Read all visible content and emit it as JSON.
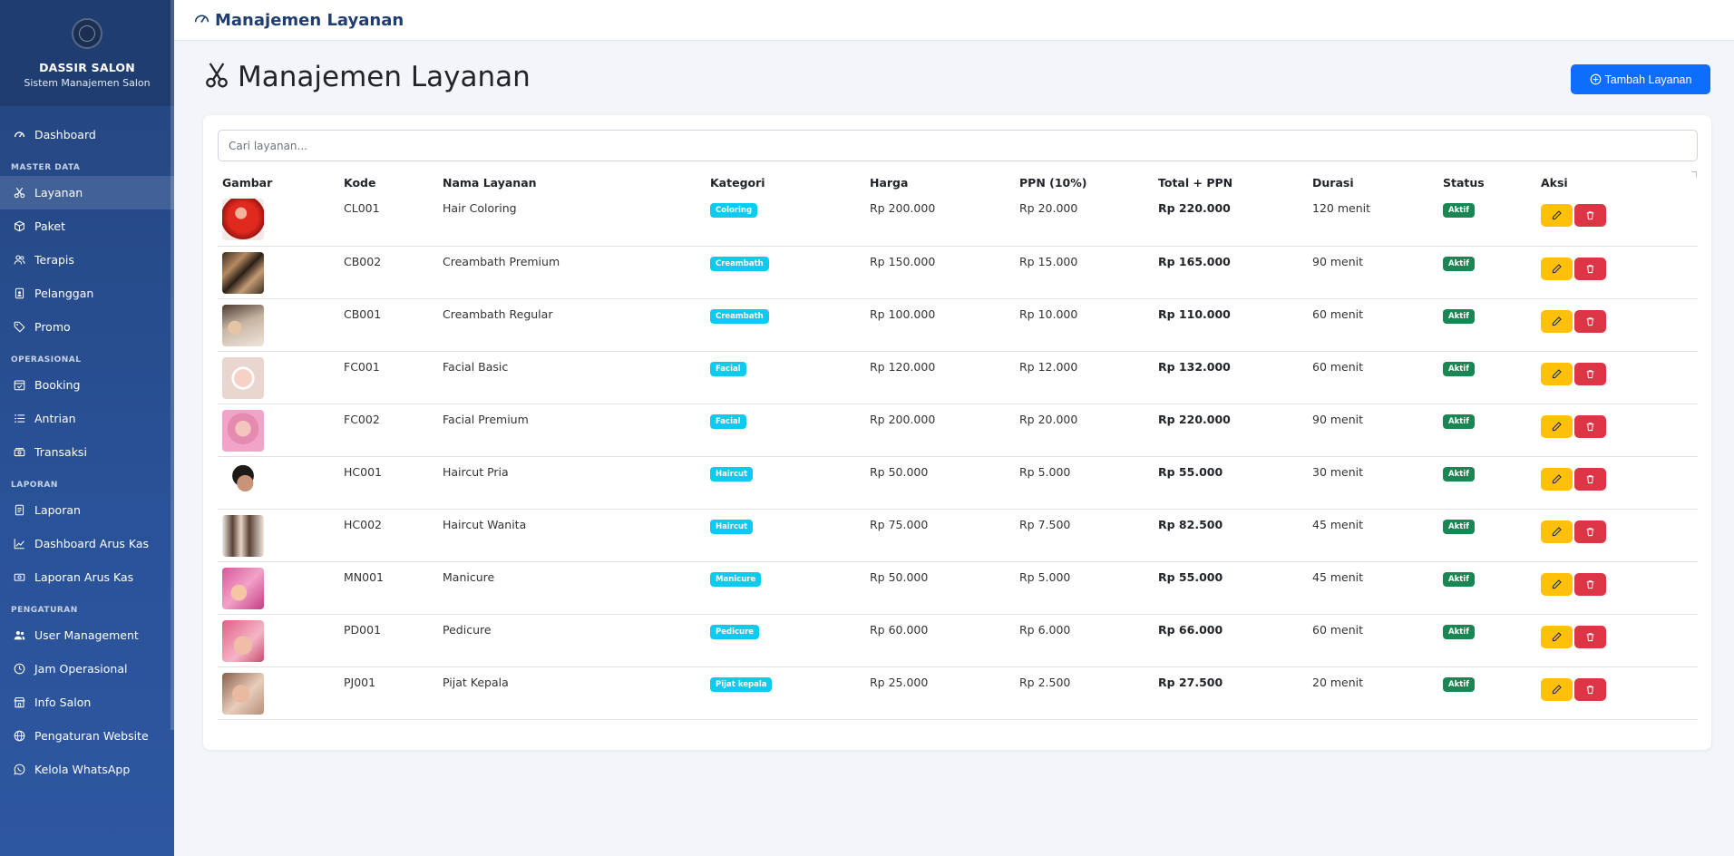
{
  "brand": {
    "name": "DASSIR SALON",
    "subtitle": "Sistem Manajemen Salon"
  },
  "sidebar": {
    "dashboard": "Dashboard",
    "sections": {
      "master": "MASTER DATA",
      "operasional": "OPERASIONAL",
      "laporan": "LAPORAN",
      "pengaturan": "PENGATURAN"
    },
    "master_items": [
      "Layanan",
      "Paket",
      "Terapis",
      "Pelanggan",
      "Promo"
    ],
    "operasional_items": [
      "Booking",
      "Antrian",
      "Transaksi"
    ],
    "laporan_items": [
      "Laporan",
      "Dashboard Arus Kas",
      "Laporan Arus Kas"
    ],
    "pengaturan_items": [
      "User Management",
      "Jam Operasional",
      "Info Salon",
      "Pengaturan Website",
      "Kelola WhatsApp"
    ],
    "active": "Layanan"
  },
  "topbar": {
    "title": "Manajemen Layanan"
  },
  "page": {
    "title": "Manajemen Layanan",
    "add_button": "Tambah Layanan"
  },
  "search": {
    "placeholder": "Cari layanan..."
  },
  "table": {
    "headers": [
      "Gambar",
      "Kode",
      "Nama Layanan",
      "Kategori",
      "Harga",
      "PPN (10%)",
      "Total + PPN",
      "Durasi",
      "Status",
      "Aksi"
    ],
    "rows": [
      {
        "kode": "CL001",
        "nama": "Hair Coloring",
        "kategori": "Coloring",
        "harga": "Rp 200.000",
        "ppn": "Rp 20.000",
        "total": "Rp 220.000",
        "durasi": "120 menit",
        "status": "Aktif"
      },
      {
        "kode": "CB002",
        "nama": "Creambath Premium",
        "kategori": "Creambath",
        "harga": "Rp 150.000",
        "ppn": "Rp 15.000",
        "total": "Rp 165.000",
        "durasi": "90 menit",
        "status": "Aktif"
      },
      {
        "kode": "CB001",
        "nama": "Creambath Regular",
        "kategori": "Creambath",
        "harga": "Rp 100.000",
        "ppn": "Rp 10.000",
        "total": "Rp 110.000",
        "durasi": "60 menit",
        "status": "Aktif"
      },
      {
        "kode": "FC001",
        "nama": "Facial Basic",
        "kategori": "Facial",
        "harga": "Rp 120.000",
        "ppn": "Rp 12.000",
        "total": "Rp 132.000",
        "durasi": "60 menit",
        "status": "Aktif"
      },
      {
        "kode": "FC002",
        "nama": "Facial Premium",
        "kategori": "Facial",
        "harga": "Rp 200.000",
        "ppn": "Rp 20.000",
        "total": "Rp 220.000",
        "durasi": "90 menit",
        "status": "Aktif"
      },
      {
        "kode": "HC001",
        "nama": "Haircut Pria",
        "kategori": "Haircut",
        "harga": "Rp 50.000",
        "ppn": "Rp 5.000",
        "total": "Rp 55.000",
        "durasi": "30 menit",
        "status": "Aktif"
      },
      {
        "kode": "HC002",
        "nama": "Haircut Wanita",
        "kategori": "Haircut",
        "harga": "Rp 75.000",
        "ppn": "Rp 7.500",
        "total": "Rp 82.500",
        "durasi": "45 menit",
        "status": "Aktif"
      },
      {
        "kode": "MN001",
        "nama": "Manicure",
        "kategori": "Manicure",
        "harga": "Rp 50.000",
        "ppn": "Rp 5.000",
        "total": "Rp 55.000",
        "durasi": "45 menit",
        "status": "Aktif"
      },
      {
        "kode": "PD001",
        "nama": "Pedicure",
        "kategori": "Pedicure",
        "harga": "Rp 60.000",
        "ppn": "Rp 6.000",
        "total": "Rp 66.000",
        "durasi": "60 menit",
        "status": "Aktif"
      },
      {
        "kode": "PJ001",
        "nama": "Pijat Kepala",
        "kategori": "Pijat kepala",
        "harga": "Rp 25.000",
        "ppn": "Rp 2.500",
        "total": "Rp 27.500",
        "durasi": "20 menit",
        "status": "Aktif"
      }
    ]
  },
  "colors": {
    "sidebar": "#2a5298",
    "primary": "#0d6efd",
    "category_badge": "#0dcaf0",
    "status_badge": "#198754",
    "edit_button": "#ffc107",
    "delete_button": "#dc3545"
  },
  "thumbnails": [
    "red-hair",
    "braids",
    "hair-wash",
    "facial-mask",
    "pink-facial",
    "man-haircut",
    "long-hair",
    "manicure-nails",
    "pedicure",
    "head-massage"
  ]
}
